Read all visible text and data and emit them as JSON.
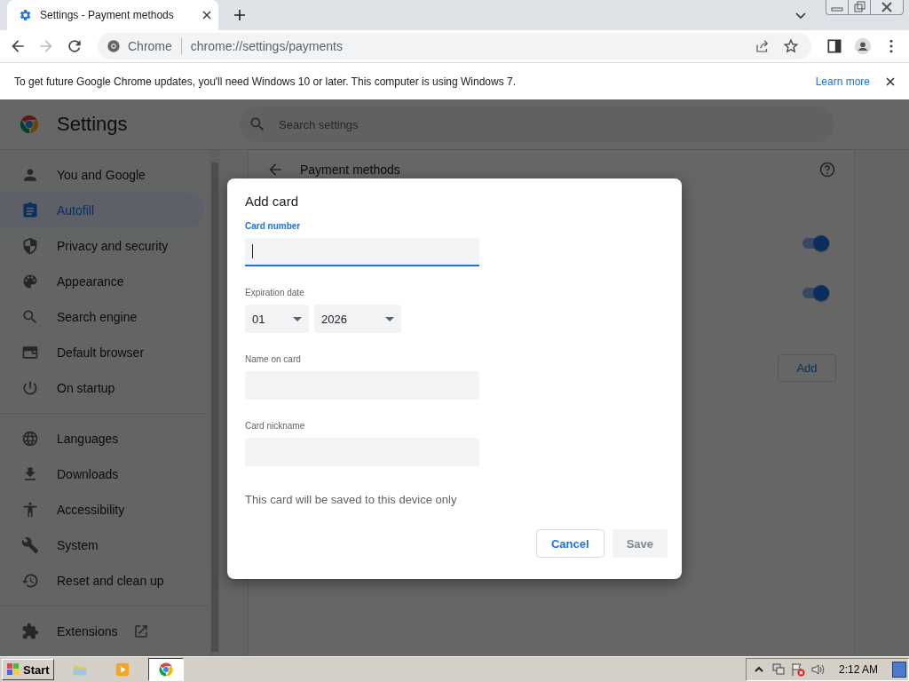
{
  "tab": {
    "title": "Settings - Payment methods"
  },
  "address_bar": {
    "origin": "Chrome",
    "url": "chrome://settings/payments"
  },
  "infobar": {
    "message": "To get future Google Chrome updates, you'll need Windows 10 or later. This computer is using Windows 7.",
    "link": "Learn more"
  },
  "settings": {
    "title": "Settings",
    "search": {
      "placeholder": "Search settings"
    },
    "sidebar": [
      [
        {
          "label": "You and Google",
          "selected": false
        },
        {
          "label": "Autofill",
          "selected": true
        },
        {
          "label": "Privacy and security",
          "selected": false
        },
        {
          "label": "Appearance",
          "selected": false
        },
        {
          "label": "Search engine",
          "selected": false
        },
        {
          "label": "Default browser",
          "selected": false
        },
        {
          "label": "On startup",
          "selected": false
        }
      ],
      [
        {
          "label": "Languages",
          "selected": false
        },
        {
          "label": "Downloads",
          "selected": false
        },
        {
          "label": "Accessibility",
          "selected": false
        },
        {
          "label": "System",
          "selected": false
        },
        {
          "label": "Reset and clean up",
          "selected": false
        }
      ],
      [
        {
          "label": "Extensions",
          "selected": false,
          "external": true
        }
      ]
    ],
    "section_title": "Payment methods",
    "toggles": [
      {
        "on": true
      },
      {
        "on": true
      }
    ],
    "add_button": "Add"
  },
  "dialog": {
    "title": "Add card",
    "fields": [
      {
        "kind": "text",
        "label": "Card number",
        "focused": true
      },
      {
        "kind": "selects",
        "label": "Expiration date",
        "values": [
          "01",
          "2026"
        ]
      },
      {
        "kind": "text",
        "label": "Name on card",
        "focused": false
      },
      {
        "kind": "text",
        "label": "Card nickname",
        "focused": false
      }
    ],
    "note": "This card will be saved to this device only",
    "buttons": [
      {
        "label": "Cancel",
        "kind": "secondary",
        "disabled": false
      },
      {
        "label": "Save",
        "kind": "primary",
        "disabled": true
      }
    ]
  },
  "taskbar": {
    "start": "Start",
    "apps": [
      {
        "active": false
      },
      {
        "active": false
      },
      {
        "active": true
      }
    ],
    "clock": "2:12 AM"
  }
}
